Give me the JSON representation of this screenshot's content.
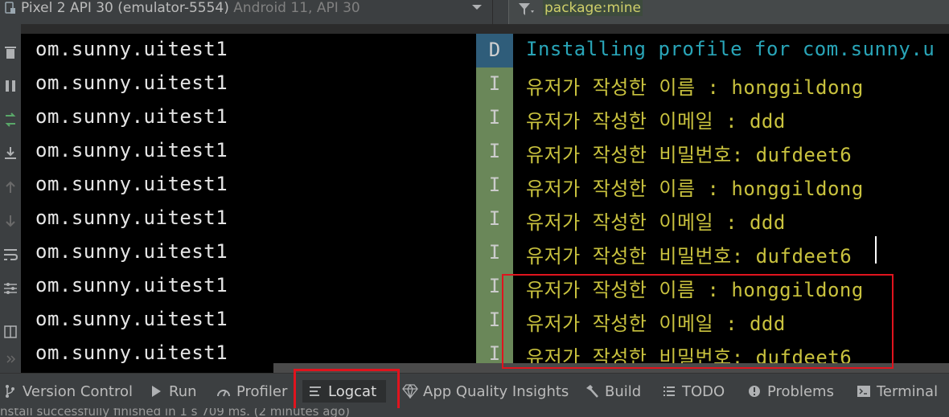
{
  "device_selector": {
    "device": "Pixel 2 API 30 (emulator-5554)",
    "api": "Android 11, API 30"
  },
  "filter": {
    "value": "package:mine"
  },
  "log_rows": [
    {
      "package": "om.sunny.uitest1",
      "level": "D",
      "message": "Installing profile for com.sunny.u"
    },
    {
      "package": "om.sunny.uitest1",
      "level": "I",
      "message": "유저가 작성한 이름 : honggildong"
    },
    {
      "package": "om.sunny.uitest1",
      "level": "I",
      "message": "유저가 작성한 이메일 : ddd"
    },
    {
      "package": "om.sunny.uitest1",
      "level": "I",
      "message": "유저가 작성한 비밀번호: dufdeet6"
    },
    {
      "package": "om.sunny.uitest1",
      "level": "I",
      "message": "유저가 작성한 이름 : honggildong"
    },
    {
      "package": "om.sunny.uitest1",
      "level": "I",
      "message": "유저가 작성한 이메일 : ddd"
    },
    {
      "package": "om.sunny.uitest1",
      "level": "I",
      "message": "유저가 작성한 비밀번호: dufdeet6"
    },
    {
      "package": "om.sunny.uitest1",
      "level": "I",
      "message": "유저가 작성한 이름 : honggildong"
    },
    {
      "package": "om.sunny.uitest1",
      "level": "I",
      "message": "유저가 작성한 이메일 : ddd"
    },
    {
      "package": "om.sunny.uitest1",
      "level": "I",
      "message": "유저가 작성한 비밀번호: dufdeet6"
    }
  ],
  "bottom_tabs": {
    "version_control": "Version Control",
    "run": "Run",
    "profiler": "Profiler",
    "logcat": "Logcat",
    "app_quality": "App Quality Insights",
    "build": "Build",
    "todo": "TODO",
    "problems": "Problems",
    "terminal": "Terminal"
  },
  "status_bar": {
    "text": "nstall successfully finished in 1 s 709 ms. (2 minutes ago)"
  },
  "colors": {
    "info_level_bg": "#6a8759",
    "debug_level_bg": "#2f5d7a",
    "info_text": "#c9c23e",
    "debug_text": "#29a5b8",
    "highlight": "#e0141e"
  }
}
